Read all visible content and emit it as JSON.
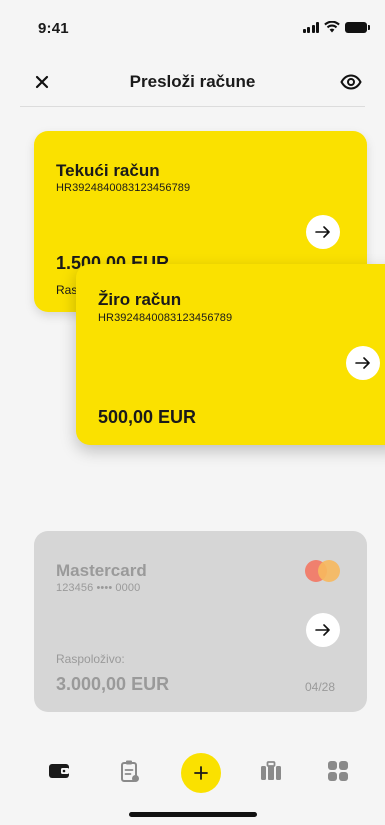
{
  "status_bar": {
    "time": "9:41"
  },
  "header": {
    "title": "Presloži račune",
    "close_icon": "close-icon",
    "visibility_icon": "eye-icon"
  },
  "accounts": [
    {
      "name": "Tekući račun",
      "iban": "HR3924840083123456789",
      "amount": "1.500,00 EUR",
      "sub_label": "Ras"
    },
    {
      "name": "Žiro račun",
      "iban": "HR3924840083123456789",
      "amount": "500,00 EUR"
    }
  ],
  "card": {
    "name": "Mastercard",
    "number": "123456 •••• 0000",
    "available_label": "Raspoloživo:",
    "amount": "3.000,00 EUR",
    "expiry": "04/28"
  },
  "bottom_nav": {
    "items": [
      "wallet-icon",
      "clipboard-icon",
      "add-icon",
      "briefcase-icon",
      "grid-icon"
    ]
  },
  "colors": {
    "accent": "#fae100",
    "card_disabled": "#d6d6d6"
  }
}
